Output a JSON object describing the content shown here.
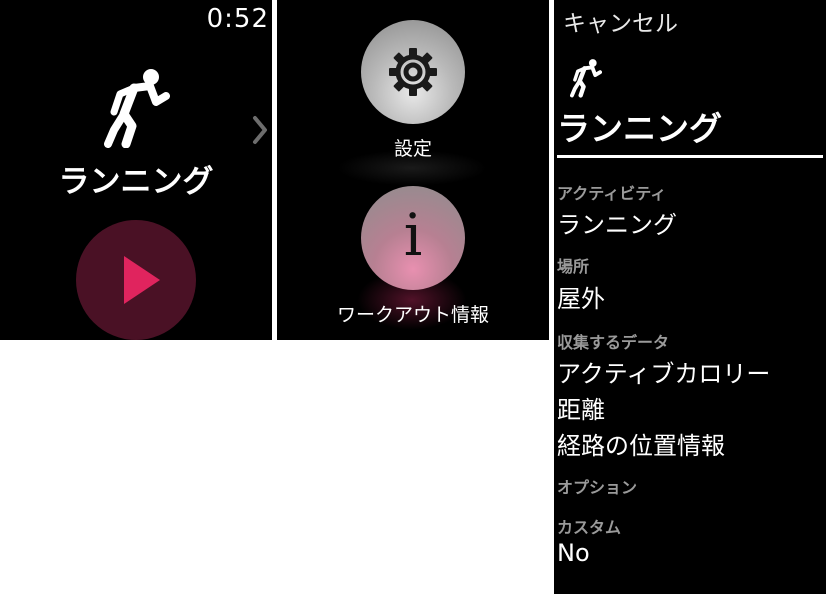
{
  "panel1": {
    "time": "0:52",
    "workout_name": "ランニング"
  },
  "panel2": {
    "settings_label": "設定",
    "info_label": "ワークアウト情報",
    "info_glyph": "i"
  },
  "panel3": {
    "cancel": "キャンセル",
    "title": "ランニング",
    "sections": [
      {
        "label": "アクティビティ",
        "values": [
          "ランニング"
        ]
      },
      {
        "label": "場所",
        "values": [
          "屋外"
        ]
      },
      {
        "label": "収集するデータ",
        "values": [
          "アクティブカロリー",
          "距離",
          "経路の位置情報"
        ]
      },
      {
        "label": "オプション",
        "values": []
      },
      {
        "label": "カスタム",
        "values": [
          "No"
        ]
      }
    ]
  },
  "colors": {
    "accent_pink": "#e0245e",
    "play_bg": "#4a1125",
    "label_gray": "#9a9a9a"
  },
  "icons": [
    "running-figure-icon",
    "chevron-right-icon",
    "play-icon",
    "gear-icon",
    "info-icon"
  ]
}
